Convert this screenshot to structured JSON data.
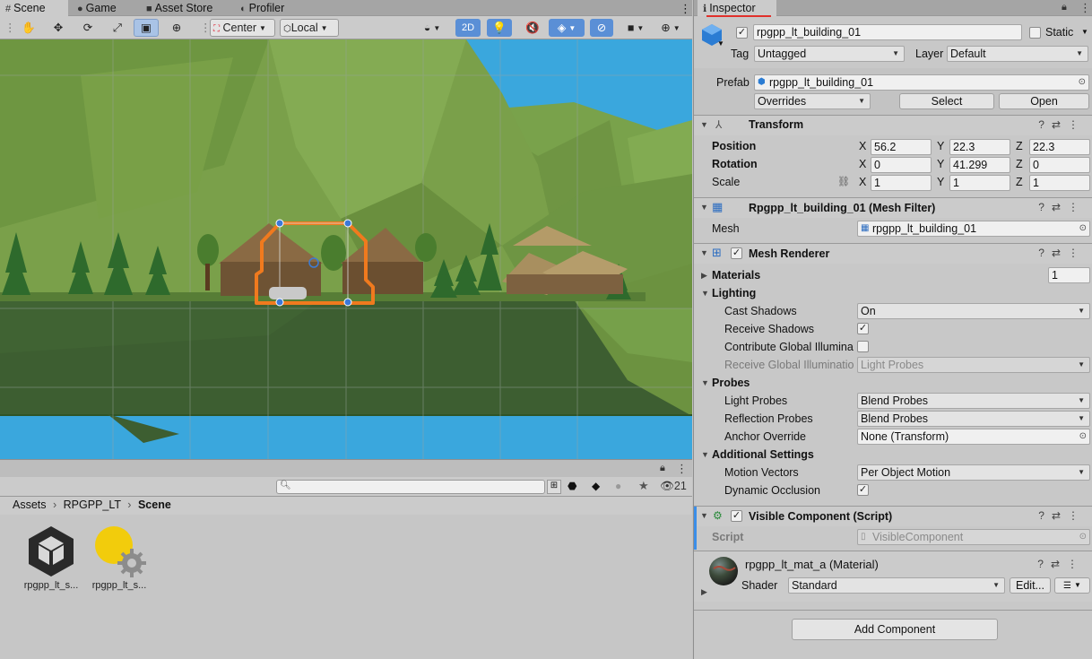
{
  "tabs": [
    {
      "label": "Scene",
      "icon": "grid-icon"
    },
    {
      "label": "Game",
      "icon": "gamepad-icon"
    },
    {
      "label": "Asset Store",
      "icon": "store-icon"
    },
    {
      "label": "Profiler",
      "icon": "profiler-icon"
    }
  ],
  "toolbar": {
    "pivot": "Center",
    "space": "Local",
    "mode_2d": "2D"
  },
  "project": {
    "count": "21",
    "breadcrumb": [
      "Assets",
      "RPGPP_LT",
      "Scene"
    ],
    "assets": [
      {
        "name": "rpgpp_lt_s...",
        "icon": "unity-scene-icon"
      },
      {
        "name": "rpgpp_lt_s...",
        "icon": "lighting-settings-icon"
      }
    ]
  },
  "inspector": {
    "tab": "Inspector",
    "object_name": "rpgpp_lt_building_01",
    "static_label": "Static",
    "tag_label": "Tag",
    "tag_value": "Untagged",
    "layer_label": "Layer",
    "layer_value": "Default",
    "prefab_label": "Prefab",
    "prefab_value": "rpgpp_lt_building_01",
    "overrides": "Overrides",
    "select": "Select",
    "open": "Open",
    "transform": {
      "title": "Transform",
      "position_label": "Position",
      "rotation_label": "Rotation",
      "scale_label": "Scale",
      "position": {
        "x": "56.2",
        "y": "22.3",
        "z": "22.3"
      },
      "rotation": {
        "x": "0",
        "y": "41.299",
        "z": "0"
      },
      "scale": {
        "x": "1",
        "y": "1",
        "z": "1"
      }
    },
    "mesh_filter": {
      "title": "Rpgpp_lt_building_01 (Mesh Filter)",
      "mesh_label": "Mesh",
      "mesh_value": "rpgpp_lt_building_01"
    },
    "mesh_renderer": {
      "title": "Mesh Renderer",
      "materials_label": "Materials",
      "materials_count": "1",
      "lighting_label": "Lighting",
      "cast_shadows_label": "Cast Shadows",
      "cast_shadows_value": "On",
      "receive_shadows_label": "Receive Shadows",
      "contribute_gi_label": "Contribute Global Illumina",
      "receive_gi_label": "Receive Global Illuminatio",
      "receive_gi_value": "Light Probes",
      "probes_label": "Probes",
      "light_probes_label": "Light Probes",
      "light_probes_value": "Blend Probes",
      "reflection_probes_label": "Reflection Probes",
      "reflection_probes_value": "Blend Probes",
      "anchor_override_label": "Anchor Override",
      "anchor_override_value": "None (Transform)",
      "additional_label": "Additional Settings",
      "motion_vectors_label": "Motion Vectors",
      "motion_vectors_value": "Per Object Motion",
      "dynamic_occlusion_label": "Dynamic Occlusion"
    },
    "visible_component": {
      "title": "Visible Component (Script)",
      "script_label": "Script",
      "script_value": "VisibleComponent"
    },
    "material": {
      "title": "rpgpp_lt_mat_a (Material)",
      "shader_label": "Shader",
      "shader_value": "Standard",
      "edit": "Edit..."
    },
    "add_component": "Add Component"
  },
  "colors": {
    "sky": "#3aa7dd",
    "grass": "#7a9a48",
    "ground_dark": "#3c5c30",
    "selection": "#f07a1e",
    "accent_underline": "#e0302b"
  }
}
